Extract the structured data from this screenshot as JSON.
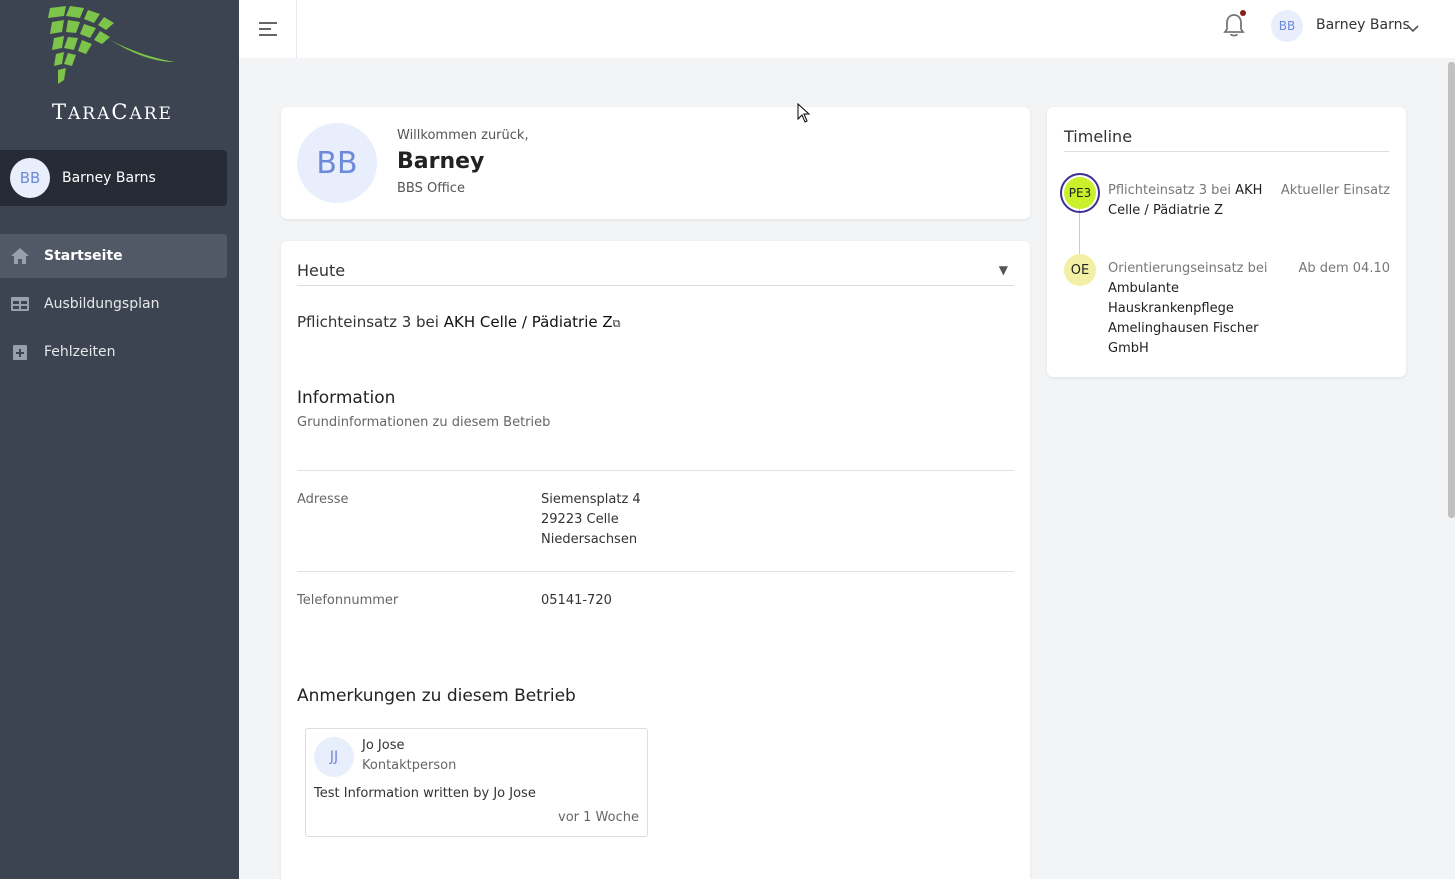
{
  "brand": {
    "name_first": "T",
    "name_rest": "ARA",
    "name_first2": "C",
    "name_rest2": "ARE",
    "logo_color": "#7cc44a"
  },
  "sidebar": {
    "user": {
      "initials": "BB",
      "name": "Barney Barns"
    },
    "items": [
      {
        "label": "Startseite",
        "icon": "home-icon",
        "active": true
      },
      {
        "label": "Ausbildungsplan",
        "icon": "table-icon",
        "active": false
      },
      {
        "label": "Fehlzeiten",
        "icon": "calendar-plus-icon",
        "active": false
      }
    ]
  },
  "topbar": {
    "initials": "BB",
    "user_name": "Barney Barns",
    "notification_dot_color": "#8a1c1c"
  },
  "welcome": {
    "initials": "BB",
    "greeting": "Willkommen zurück,",
    "name": "Barney",
    "org": "BBS Office"
  },
  "today": {
    "title": "Heute",
    "assignment_prefix": "Pflichteinsatz 3 bei ",
    "assignment_place": "AKH Celle / Pädiatrie Z",
    "info_title": "Information",
    "info_subtitle": "Grundinformationen zu diesem Betrieb",
    "address_label": "Adresse",
    "address_lines": [
      "Siemensplatz 4",
      "29223 Celle",
      "Niedersachsen"
    ],
    "phone_label": "Telefonnummer",
    "phone": "05141-720",
    "notes_title": "Anmerkungen zu diesem Betrieb",
    "note": {
      "initials": "JJ",
      "author": "Jo Jose",
      "role": "Kontaktperson",
      "text": "Test Information written by Jo Jose",
      "time": "vor 1 Woche"
    }
  },
  "timeline": {
    "title": "Timeline",
    "entries": [
      {
        "badge": "PE3",
        "text_prefix": "Pflichteinsatz 3 bei ",
        "text_place": "AKH Celle / Pädiatrie Z",
        "status": "Aktueller Einsatz",
        "badge_color": "#c9f02a"
      },
      {
        "badge": "OE",
        "text_prefix": "Orientierungseinsatz bei ",
        "text_place": "Ambulante Hauskrankenpflege Amelinghausen Fischer GmbH",
        "status": "Ab dem 04.10",
        "badge_color": "#f3f0a6"
      }
    ]
  }
}
